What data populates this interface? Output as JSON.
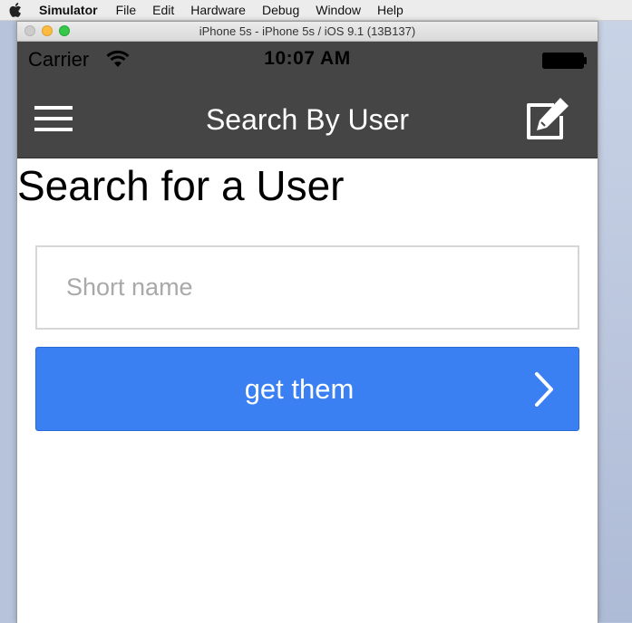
{
  "menubar": {
    "apple_icon": "apple-icon",
    "items": [
      "Simulator",
      "File",
      "Edit",
      "Hardware",
      "Debug",
      "Window",
      "Help"
    ]
  },
  "window": {
    "title": "iPhone 5s - iPhone 5s / iOS 9.1 (13B137)"
  },
  "statusbar": {
    "carrier": "Carrier",
    "time": "10:07 AM",
    "icons": [
      "wifi-icon",
      "battery-icon"
    ]
  },
  "navbar": {
    "title": "Search By User",
    "left_icon": "menu-icon",
    "right_icon": "edit-icon",
    "background": "#454545"
  },
  "page": {
    "heading": "Search for a User",
    "input": {
      "value": "",
      "placeholder": "Short name"
    },
    "button": {
      "label": "get them",
      "icon": "chevron-right-icon",
      "color": "#3a80f2"
    }
  }
}
